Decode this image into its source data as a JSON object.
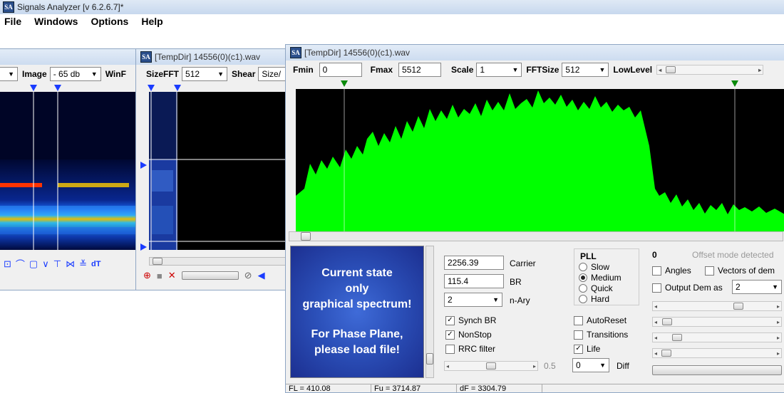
{
  "app": {
    "title": "Signals Analyzer [v 6.2.6.7]*",
    "logo": "SA"
  },
  "menu": [
    "File",
    "Windows",
    "Options",
    "Help"
  ],
  "win_left": {
    "image_label": "Image",
    "image_value": "- 65 db",
    "winf_label": "WinF",
    "tools": [
      "dT"
    ]
  },
  "win_mid": {
    "title": "[TempDir] 14556(0)(c1).wav",
    "sizefft_label": "SizeFFT",
    "sizefft_value": "512",
    "shear_label": "Shear",
    "shear_value": "Size/"
  },
  "win_main": {
    "title": "[TempDir] 14556(0)(c1).wav",
    "fmin_label": "Fmin",
    "fmin_value": "0",
    "fmax_label": "Fmax",
    "fmax_value": "5512",
    "scale_label": "Scale",
    "scale_value": "1",
    "fftsize_label": "FFTSize",
    "fftsize_value": "512",
    "lowlevel_label": "LowLevel",
    "spectrum_color": "#00ff00",
    "status": {
      "fl": "FL = 410.08",
      "fu": "Fu = 3714.87",
      "df": "dF = 3304.79"
    }
  },
  "phase_panel": {
    "line1": "Current state",
    "line2": "only",
    "line3": "graphical spectrum!",
    "line4": "For Phase Plane,",
    "line5": "please load file!"
  },
  "controls": {
    "carrier_value": "2256.39",
    "carrier_label": "Carrier",
    "br_value": "115.4",
    "br_label": "BR",
    "nary_value": "2",
    "nary_label": "n-Ary",
    "pll_label": "PLL",
    "pll_options": [
      "Slow",
      "Medium",
      "Quick",
      "Hard"
    ],
    "pll_selected": "Medium",
    "synch_br": "Synch BR",
    "nonstop": "NonStop",
    "rrc_filter": "RRC filter",
    "autoreset": "AutoReset",
    "transitions": "Transitions",
    "life": "Life",
    "slider_value": "0.5",
    "diff_value": "0",
    "diff_label": "Diff",
    "offset_count": "0",
    "offset_text": "Offset mode detected",
    "angles": "Angles",
    "vectors": "Vectors of dem",
    "output_dem": "Output Dem as",
    "output_dem_value": "2"
  }
}
